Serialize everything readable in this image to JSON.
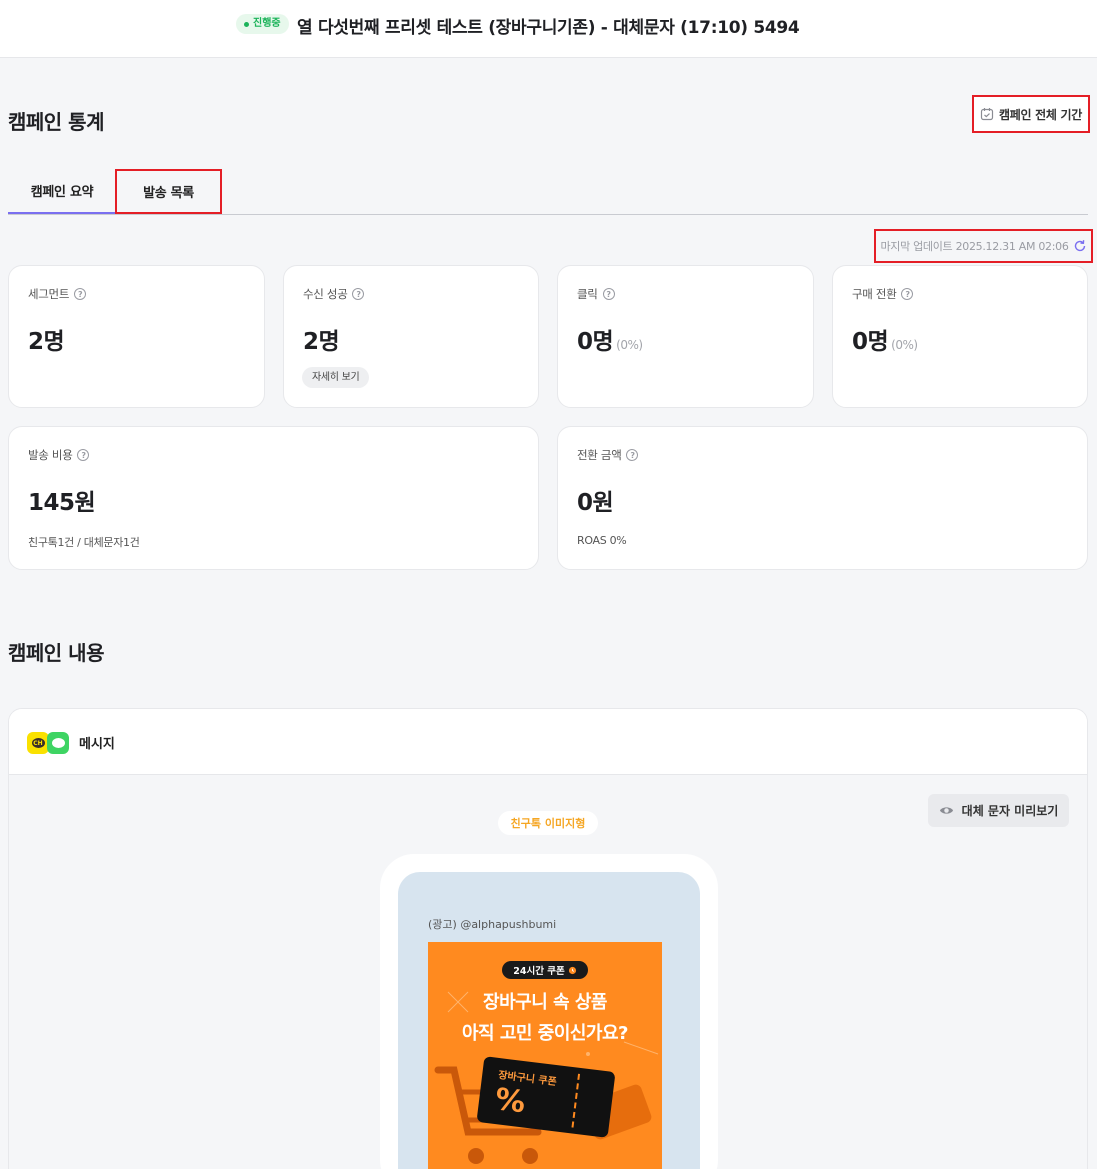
{
  "header": {
    "status": "진행중",
    "title": "열 다섯번째 프리셋 테스트 (장바구니기존) - 대체문자 (17:10) 5494"
  },
  "stats": {
    "section_title": "캠페인 통계",
    "period_button": "캠페인 전체 기간",
    "tabs": [
      {
        "label": "캠페인 요약",
        "active": true
      },
      {
        "label": "발송 목록",
        "active": false
      }
    ],
    "last_update": "마지막 업데이트 2025.12.31 AM 02:06",
    "cards": [
      {
        "label": "세그먼트",
        "value": "2명"
      },
      {
        "label": "수신 성공",
        "value": "2명",
        "action": "자세히 보기"
      },
      {
        "label": "클릭",
        "value": "0명",
        "percent": "(0%)"
      },
      {
        "label": "구매 전환",
        "value": "0명",
        "percent": "(0%)"
      }
    ],
    "wide_cards": [
      {
        "label": "발송 비용",
        "value": "145원",
        "sub": "친구톡1건 / 대체문자1건"
      },
      {
        "label": "전환 금액",
        "value": "0원",
        "sub": "ROAS 0%"
      }
    ]
  },
  "content": {
    "section_title": "캠페인 내용",
    "channel_label": "메시지",
    "preview_button": "대체 문자 미리보기",
    "message_type": "친구톡 이미지형",
    "ad_sender": "(광고) @alphapushbumi",
    "ad_image": {
      "badge": "24시간 쿠폰",
      "line1": "장바구니 속 상품",
      "line2": "아직 고민 중이신가요?",
      "ticket_label": "장바구니 쿠폰",
      "ticket_symbol": "%"
    }
  },
  "colors": {
    "accent": "#7a6ff0",
    "status_green": "#1cb35a",
    "highlight_red": "#e41e26",
    "ad_orange": "#ff8a1f"
  }
}
